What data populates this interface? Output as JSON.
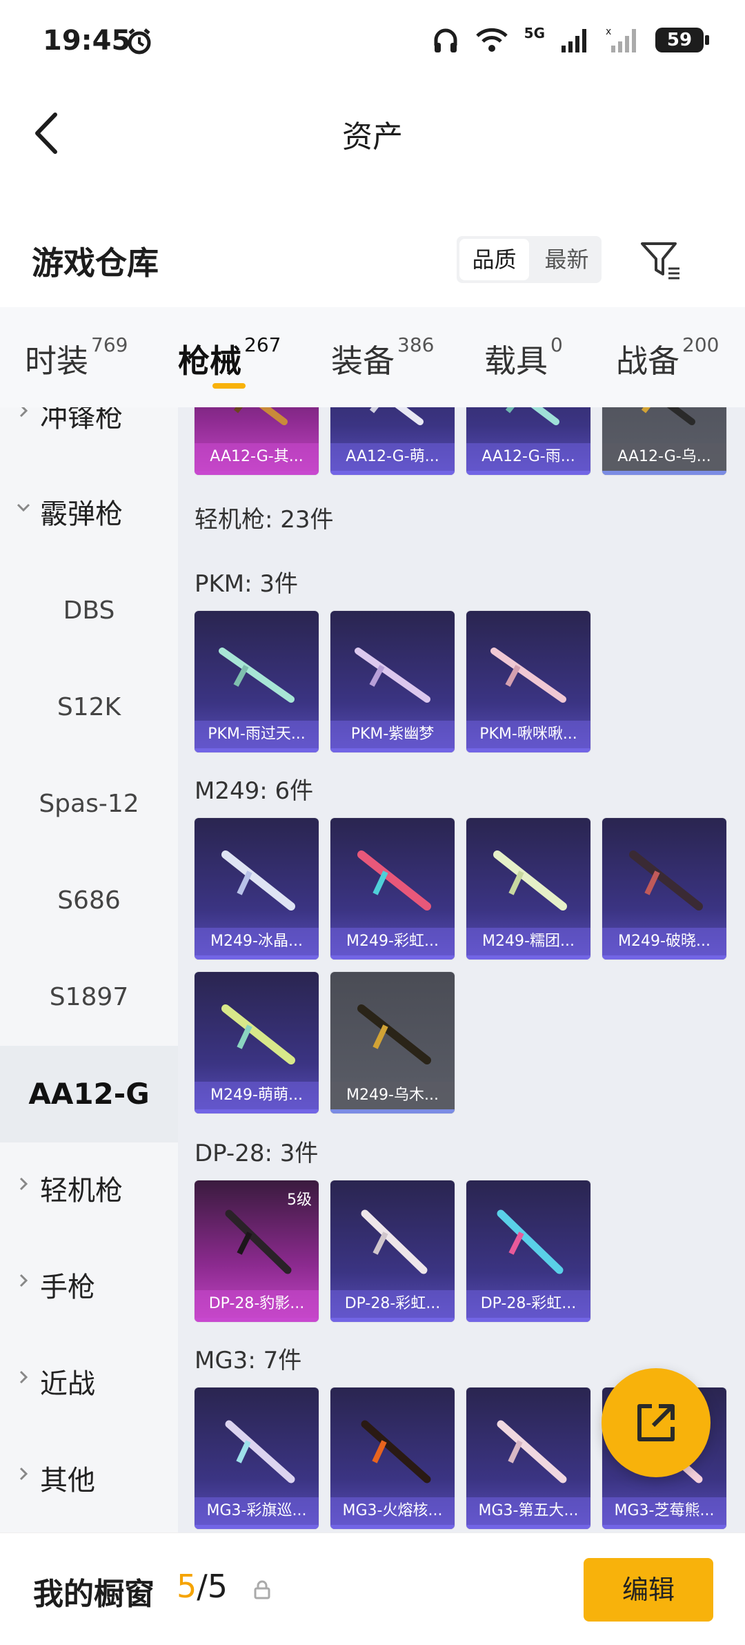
{
  "status": {
    "time": "19:45",
    "battery": "59",
    "network": "5G"
  },
  "header": {
    "title": "资产"
  },
  "warehouse": {
    "title": "游戏仓库",
    "sort_options": [
      "品质",
      "最新"
    ],
    "active_sort": "品质"
  },
  "tabs": [
    {
      "label": "时装",
      "count": "769"
    },
    {
      "label": "枪械",
      "count": "267"
    },
    {
      "label": "装备",
      "count": "386"
    },
    {
      "label": "载具",
      "count": "0"
    },
    {
      "label": "战备",
      "count": "200"
    }
  ],
  "sidebar": {
    "items": [
      {
        "label": "冲锋枪",
        "type": "category",
        "expanded": false
      },
      {
        "label": "霰弹枪",
        "type": "category",
        "expanded": true
      },
      {
        "label": "DBS",
        "type": "sub"
      },
      {
        "label": "S12K",
        "type": "sub"
      },
      {
        "label": "Spas-12",
        "type": "sub"
      },
      {
        "label": "S686",
        "type": "sub"
      },
      {
        "label": "S1897",
        "type": "sub"
      },
      {
        "label": "AA12-G",
        "type": "sub",
        "selected": true
      },
      {
        "label": "轻机枪",
        "type": "category",
        "expanded": false
      },
      {
        "label": "手枪",
        "type": "category",
        "expanded": false
      },
      {
        "label": "近战",
        "type": "category",
        "expanded": false
      },
      {
        "label": "其他",
        "type": "category",
        "expanded": false
      }
    ]
  },
  "content": {
    "top_row": [
      {
        "name": "AA12-G-其...",
        "style": "pink"
      },
      {
        "name": "AA12-G-萌...",
        "style": "purple"
      },
      {
        "name": "AA12-G-雨...",
        "style": "purple"
      },
      {
        "name": "AA12-G-乌...",
        "style": "grey"
      }
    ],
    "group_title": "轻机枪: 23件",
    "sections": [
      {
        "title": "PKM: 3件",
        "items": [
          {
            "name": "PKM-雨过天...",
            "style": "purple"
          },
          {
            "name": "PKM-紫幽梦",
            "style": "purple"
          },
          {
            "name": "PKM-啾咪啾...",
            "style": "purple"
          }
        ]
      },
      {
        "title": "M249: 6件",
        "items": [
          {
            "name": "M249-冰晶...",
            "style": "purple"
          },
          {
            "name": "M249-彩虹...",
            "style": "purple"
          },
          {
            "name": "M249-糯团...",
            "style": "purple"
          },
          {
            "name": "M249-破晓...",
            "style": "purple"
          },
          {
            "name": "M249-萌萌...",
            "style": "purple"
          },
          {
            "name": "M249-乌木...",
            "style": "grey"
          }
        ]
      },
      {
        "title": "DP-28: 3件",
        "items": [
          {
            "name": "DP-28-豹影...",
            "style": "pink",
            "level": "5级"
          },
          {
            "name": "DP-28-彩虹...",
            "style": "purple"
          },
          {
            "name": "DP-28-彩虹...",
            "style": "purple"
          }
        ]
      },
      {
        "title": "MG3: 7件",
        "items": [
          {
            "name": "MG3-彩旗巡...",
            "style": "purple"
          },
          {
            "name": "MG3-火熔核...",
            "style": "purple"
          },
          {
            "name": "MG3-第五大...",
            "style": "purple"
          },
          {
            "name": "MG3-芝莓熊...",
            "style": "purple"
          }
        ]
      }
    ]
  },
  "bottom": {
    "title": "我的橱窗",
    "count_current": "5",
    "count_sep_total": "/5",
    "edit_label": "编辑"
  },
  "colors": {
    "accent": "#f8b20b",
    "card_purple": "#3b3483",
    "card_pink": "#8c2a8f",
    "card_grey": "#5b5e68"
  }
}
